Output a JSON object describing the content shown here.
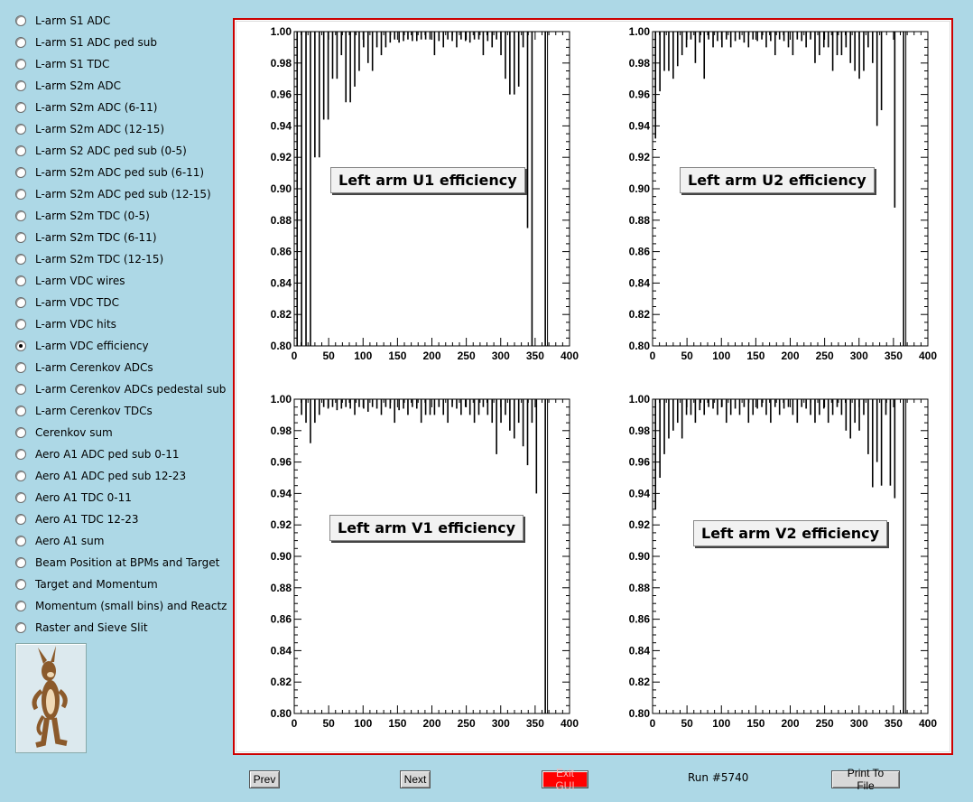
{
  "sidebar": {
    "items": [
      {
        "label": "L-arm S1 ADC",
        "selected": false
      },
      {
        "label": "L-arm S1 ADC ped sub",
        "selected": false
      },
      {
        "label": "L-arm S1 TDC",
        "selected": false
      },
      {
        "label": "L-arm S2m ADC",
        "selected": false
      },
      {
        "label": "L-arm S2m ADC (6-11)",
        "selected": false
      },
      {
        "label": "L-arm S2m ADC (12-15)",
        "selected": false
      },
      {
        "label": "L-arm S2 ADC ped sub (0-5)",
        "selected": false
      },
      {
        "label": "L-arm S2m ADC ped sub (6-11)",
        "selected": false
      },
      {
        "label": "L-arm S2m ADC ped sub (12-15)",
        "selected": false
      },
      {
        "label": "L-arm S2m TDC (0-5)",
        "selected": false
      },
      {
        "label": "L-arm S2m TDC (6-11)",
        "selected": false
      },
      {
        "label": "L-arm S2m TDC (12-15)",
        "selected": false
      },
      {
        "label": "L-arm VDC wires",
        "selected": false
      },
      {
        "label": "L-arm VDC TDC",
        "selected": false
      },
      {
        "label": "L-arm VDC hits",
        "selected": false
      },
      {
        "label": "L-arm VDC efficiency",
        "selected": true
      },
      {
        "label": "L-arm Cerenkov ADCs",
        "selected": false
      },
      {
        "label": "L-arm Cerenkov ADCs pedestal sub",
        "selected": false
      },
      {
        "label": "L-arm Cerenkov TDCs",
        "selected": false
      },
      {
        "label": "Cerenkov sum",
        "selected": false
      },
      {
        "label": "Aero A1 ADC ped sub 0-11",
        "selected": false
      },
      {
        "label": "Aero A1 ADC ped sub 12-23",
        "selected": false
      },
      {
        "label": "Aero A1 TDC 0-11",
        "selected": false
      },
      {
        "label": "Aero A1 TDC 12-23",
        "selected": false
      },
      {
        "label": "Aero A1 sum",
        "selected": false
      },
      {
        "label": "Beam Position at BPMs and Target",
        "selected": false
      },
      {
        "label": "Target and Momentum",
        "selected": false
      },
      {
        "label": "Momentum (small bins) and Reactz",
        "selected": false
      },
      {
        "label": "Raster and Sieve Slit",
        "selected": false
      }
    ]
  },
  "buttons": {
    "prev": "Prev",
    "next": "Next",
    "exit": "Exit GUI",
    "print": "Print To File"
  },
  "run_label": "Run #5740",
  "colors": {
    "background": "#add8e6",
    "frame_border": "#cc0000",
    "exit_button": "#ff0000"
  },
  "chart_data": [
    {
      "type": "bar",
      "title": "Left arm U1 efficiency",
      "xlim": [
        0,
        400
      ],
      "ylim": [
        0.8,
        1.0
      ],
      "x_ticks": [
        "0",
        "50",
        "100",
        "150",
        "200",
        "250",
        "300",
        "350",
        "400"
      ],
      "y_ticks": [
        "0.80",
        "0.82",
        "0.84",
        "0.86",
        "0.88",
        "0.90",
        "0.92",
        "0.94",
        "0.96",
        "0.98",
        "1.00"
      ],
      "x_start": 1,
      "x_end": 368,
      "values": [
        0.8,
        0.8,
        0.8,
        0.8,
        0.92,
        0.92,
        0.944,
        0.944,
        0.97,
        0.97,
        0.985,
        0.955,
        0.955,
        0.965,
        0.975,
        0.99,
        0.98,
        0.975,
        0.99,
        0.985,
        0.99,
        0.993,
        0.995,
        0.993,
        0.994,
        0.995,
        0.994,
        0.994,
        0.995,
        0.995,
        0.995,
        0.985,
        0.994,
        0.99,
        0.995,
        0.994,
        0.99,
        0.995,
        0.994,
        0.993,
        0.995,
        0.995,
        0.985,
        0.994,
        0.99,
        0.995,
        0.985,
        0.97,
        0.96,
        0.96,
        0.965,
        0.99,
        0.875,
        0.8,
        1.0,
        1.0,
        0.8
      ]
    },
    {
      "type": "bar",
      "title": "Left arm U2 efficiency",
      "xlim": [
        0,
        400
      ],
      "ylim": [
        0.8,
        1.0
      ],
      "x_ticks": [
        "0",
        "50",
        "100",
        "150",
        "200",
        "250",
        "300",
        "350",
        "400"
      ],
      "y_ticks": [
        "0.80",
        "0.82",
        "0.84",
        "0.86",
        "0.88",
        "0.90",
        "0.92",
        "0.94",
        "0.96",
        "0.98",
        "1.00"
      ],
      "x_start": 1,
      "x_end": 368,
      "values": [
        0.932,
        0.962,
        0.975,
        0.975,
        0.97,
        0.978,
        0.985,
        0.99,
        0.995,
        0.98,
        0.993,
        0.97,
        0.995,
        0.99,
        0.994,
        0.99,
        0.995,
        0.99,
        0.994,
        0.995,
        0.993,
        0.99,
        0.995,
        0.994,
        0.995,
        0.99,
        0.994,
        0.985,
        0.995,
        0.994,
        0.99,
        0.985,
        0.995,
        0.994,
        0.99,
        0.995,
        0.98,
        0.985,
        0.99,
        0.99,
        0.975,
        0.985,
        0.985,
        0.99,
        0.98,
        0.975,
        0.97,
        0.975,
        0.99,
        0.98,
        0.94,
        0.95,
        1.0,
        1.0,
        0.888,
        1.0,
        0.8
      ]
    },
    {
      "type": "bar",
      "title": "Left arm V1 efficiency",
      "xlim": [
        0,
        400
      ],
      "ylim": [
        0.8,
        1.0
      ],
      "x_ticks": [
        "0",
        "50",
        "100",
        "150",
        "200",
        "250",
        "300",
        "350",
        "400"
      ],
      "y_ticks": [
        "0.80",
        "0.82",
        "0.84",
        "0.86",
        "0.88",
        "0.90",
        "0.92",
        "0.94",
        "0.96",
        "0.98",
        "1.00"
      ],
      "x_start": 1,
      "x_end": 368,
      "values": [
        1.0,
        0.99,
        0.985,
        0.972,
        0.985,
        0.99,
        0.995,
        0.994,
        0.995,
        0.993,
        0.994,
        0.995,
        0.994,
        0.99,
        0.995,
        0.994,
        0.992,
        0.995,
        0.994,
        0.99,
        0.995,
        0.994,
        0.985,
        0.993,
        0.994,
        0.99,
        0.995,
        0.994,
        0.985,
        0.99,
        0.99,
        0.99,
        0.995,
        0.99,
        0.985,
        0.995,
        0.994,
        0.99,
        0.995,
        0.99,
        0.985,
        0.99,
        0.995,
        0.99,
        0.985,
        0.965,
        0.985,
        0.99,
        0.98,
        0.975,
        0.985,
        0.97,
        0.958,
        0.985,
        0.94,
        1.0,
        0.8
      ]
    },
    {
      "type": "bar",
      "title": "Left arm V2 efficiency",
      "xlim": [
        0,
        400
      ],
      "ylim": [
        0.8,
        1.0
      ],
      "x_ticks": [
        "0",
        "50",
        "100",
        "150",
        "200",
        "250",
        "300",
        "350",
        "400"
      ],
      "y_ticks": [
        "0.80",
        "0.82",
        "0.84",
        "0.86",
        "0.88",
        "0.90",
        "0.92",
        "0.94",
        "0.96",
        "0.98",
        "1.00"
      ],
      "x_start": 1,
      "x_end": 368,
      "values": [
        0.93,
        0.95,
        0.965,
        0.975,
        0.98,
        0.985,
        0.975,
        0.99,
        0.99,
        0.985,
        0.993,
        0.99,
        0.995,
        0.994,
        0.99,
        0.995,
        0.985,
        0.99,
        0.994,
        0.99,
        0.995,
        0.985,
        0.99,
        0.994,
        0.995,
        0.99,
        0.985,
        0.995,
        0.99,
        0.994,
        0.995,
        0.99,
        0.985,
        0.995,
        0.994,
        0.99,
        0.985,
        0.99,
        0.994,
        0.985,
        0.99,
        0.995,
        0.99,
        0.98,
        0.975,
        0.985,
        0.98,
        0.99,
        0.965,
        0.944,
        0.96,
        0.945,
        0.99,
        0.945,
        0.937,
        1.0,
        0.8
      ]
    }
  ]
}
